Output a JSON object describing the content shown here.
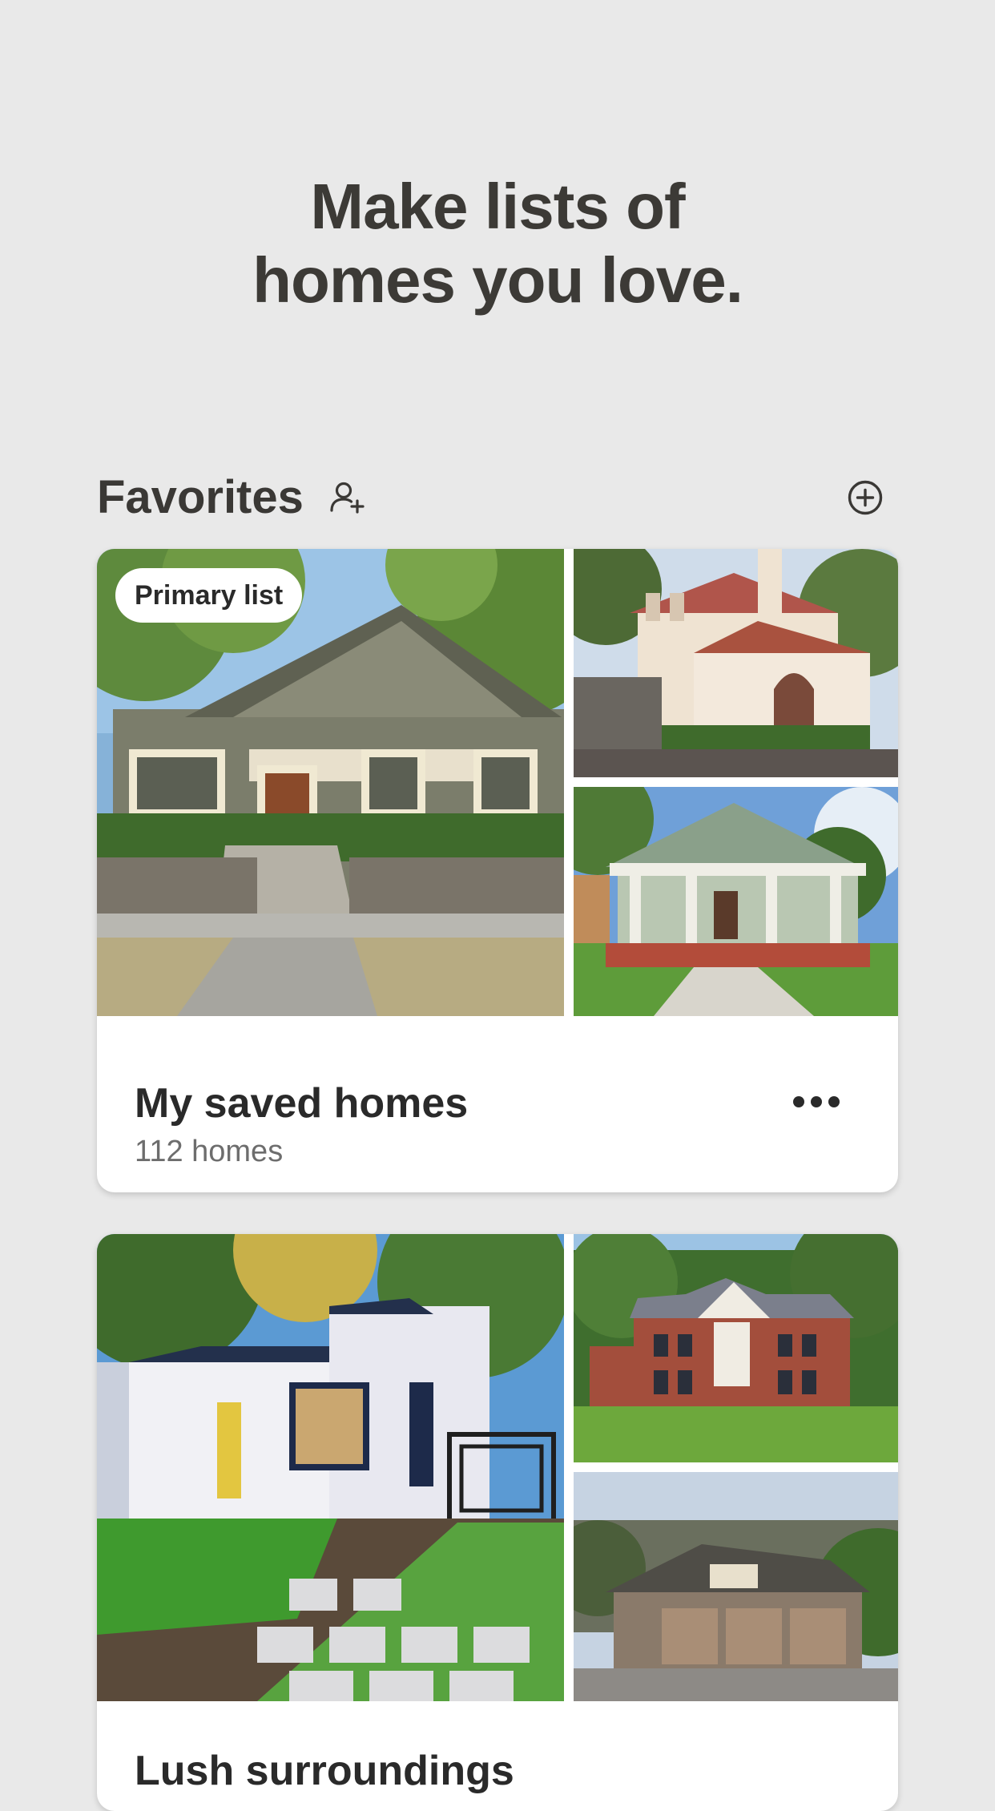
{
  "headline": {
    "line1": "Make lists of",
    "line2": "homes you love."
  },
  "favorites": {
    "title": "Favorites",
    "share_icon": "add-person-icon",
    "add_icon": "plus-circle-icon"
  },
  "lists": [
    {
      "badge": "Primary list",
      "name": "My saved homes",
      "count": "112 homes",
      "menu_icon": "more-horizontal-icon"
    },
    {
      "name": "Lush surroundings"
    }
  ],
  "colors": {
    "background": "#e9e9e9",
    "text": "#3a3835",
    "card": "#ffffff",
    "muted": "#6d6d6d"
  }
}
